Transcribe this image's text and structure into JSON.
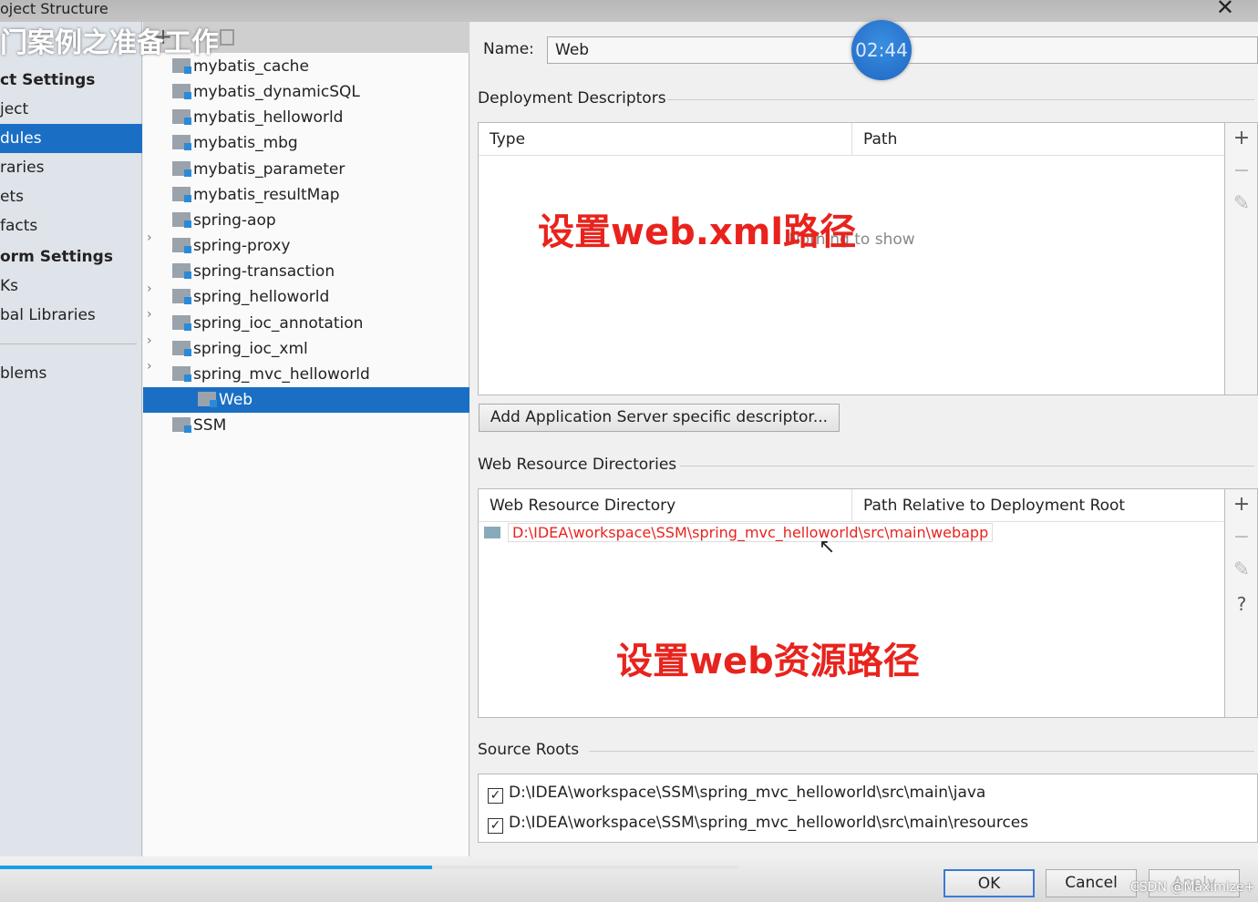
{
  "window": {
    "title": "oject Structure",
    "overlay_title": "门案例之准备工作",
    "close": "✕"
  },
  "sidebar": {
    "items": [
      {
        "label": "ct Settings",
        "head": true
      },
      {
        "label": "ject"
      },
      {
        "label": "dules",
        "selected": true
      },
      {
        "label": "raries"
      },
      {
        "label": "ets"
      },
      {
        "label": "facts"
      },
      {
        "label": "orm Settings",
        "head": true
      },
      {
        "label": "Ks"
      },
      {
        "label": "bal Libraries"
      },
      {
        "label": "blems"
      }
    ]
  },
  "tree": {
    "nodes": [
      {
        "label": "mybatis_cache"
      },
      {
        "label": "mybatis_dynamicSQL"
      },
      {
        "label": "mybatis_helloworld"
      },
      {
        "label": "mybatis_mbg"
      },
      {
        "label": "mybatis_parameter"
      },
      {
        "label": "mybatis_resultMap"
      },
      {
        "label": "spring-aop",
        "chev": "›"
      },
      {
        "label": "spring-proxy"
      },
      {
        "label": "spring-transaction",
        "chev": "›"
      },
      {
        "label": "spring_helloworld",
        "chev": "›"
      },
      {
        "label": "spring_ioc_annotation",
        "chev": "›"
      },
      {
        "label": "spring_ioc_xml",
        "chev": "›"
      },
      {
        "label": "spring_mvc_helloworld",
        "chev": "⌄"
      },
      {
        "label": "Web",
        "selected": true,
        "child": true
      },
      {
        "label": "SSM"
      }
    ]
  },
  "name_field": {
    "label": "Name:",
    "value": "Web"
  },
  "timer": "02:44",
  "deployment": {
    "title": "Deployment Descriptors",
    "col_type": "Type",
    "col_path": "Path",
    "empty": "Nothing to show",
    "add_button": "Add Application Server specific descriptor..."
  },
  "web_resources": {
    "title": "Web Resource Directories",
    "col_dir": "Web Resource Directory",
    "col_rel": "Path Relative to Deployment Root",
    "row_dir": "D:\\IDEA\\workspace\\SSM\\spring_mvc_helloworld\\src\\main\\webapp",
    "row_rel": ""
  },
  "annotations": {
    "xml": "设置web.xml路径",
    "resource": "设置web资源路径"
  },
  "source_roots": {
    "title": "Source Roots",
    "items": [
      "D:\\IDEA\\workspace\\SSM\\spring_mvc_helloworld\\src\\main\\java",
      "D:\\IDEA\\workspace\\SSM\\spring_mvc_helloworld\\src\\main\\resources"
    ]
  },
  "buttons": {
    "ok": "OK",
    "cancel": "Cancel",
    "apply": "Apply"
  },
  "watermark": "CSDN @Maximize+",
  "progress": 0.31,
  "colors": {
    "selection": "#1a6fc4",
    "annotation": "#e8231d"
  }
}
